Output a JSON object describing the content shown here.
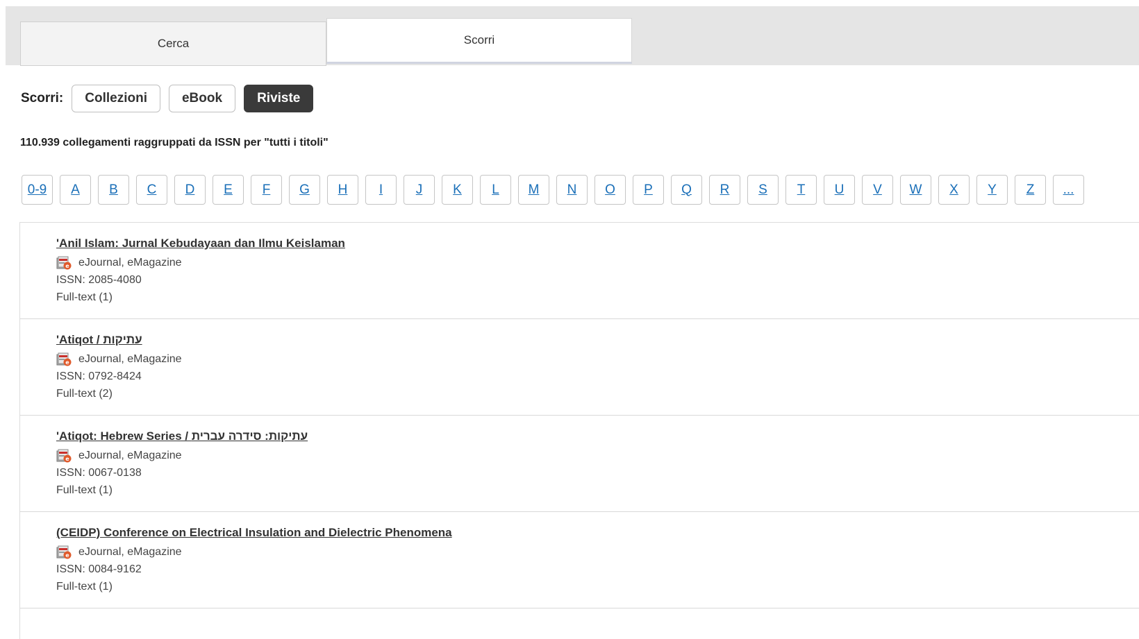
{
  "tabs": {
    "search": "Cerca",
    "browse": "Scorri"
  },
  "browse": {
    "label": "Scorri:",
    "buttons": {
      "collections": "Collezioni",
      "ebook": "eBook",
      "journals": "Riviste"
    },
    "active": "Riviste"
  },
  "summary": "110.939 collegamenti raggruppati da ISSN per \"tutti i titoli\"",
  "letters": [
    "0-9",
    "A",
    "B",
    "C",
    "D",
    "E",
    "F",
    "G",
    "H",
    "I",
    "J",
    "K",
    "L",
    "M",
    "N",
    "O",
    "P",
    "Q",
    "R",
    "S",
    "T",
    "U",
    "V",
    "W",
    "X",
    "Y",
    "Z",
    "..."
  ],
  "results": [
    {
      "title": "'Anil Islam: Jurnal Kebudayaan dan Ilmu Keislaman",
      "type": "eJournal, eMagazine",
      "issn": "ISSN: 2085-4080",
      "fulltext": "Full-text (1)"
    },
    {
      "title": "'Atiqot / עתיקות",
      "type": "eJournal, eMagazine",
      "issn": "ISSN: 0792-8424",
      "fulltext": "Full-text (2)"
    },
    {
      "title": "'Atiqot: Hebrew Series / עתיקות: סידרה עברית",
      "type": "eJournal, eMagazine",
      "issn": "ISSN: 0067-0138",
      "fulltext": "Full-text (1)"
    },
    {
      "title": "(CEIDP) Conference on Electrical Insulation and Dielectric Phenomena",
      "type": "eJournal, eMagazine",
      "issn": "ISSN: 0084-9162",
      "fulltext": "Full-text (1)"
    }
  ],
  "colors": {
    "link": "#1a6fb8",
    "active_button": "#3a3a3a",
    "tabbar_bg": "#e5e5e5",
    "icon_red": "#d9534f"
  }
}
